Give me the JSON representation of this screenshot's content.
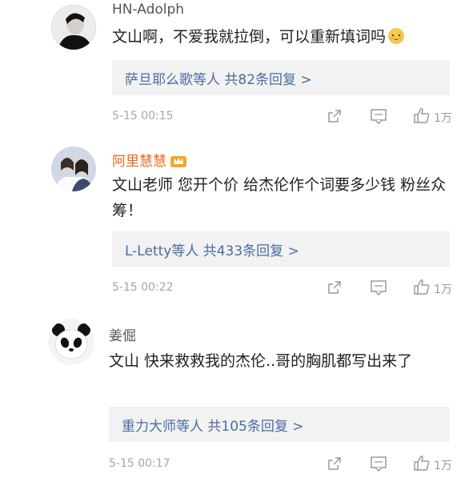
{
  "comments": [
    {
      "username": "HN-Adolph",
      "text": "文山啊，不爱我就拉倒，可以重新填词吗",
      "emoji_icon": "blush-face-emoji",
      "reply_summary": "萨旦耶么歌等人 共82条回复 >",
      "time": "5-15 00:15",
      "likes": "1万"
    },
    {
      "username": "阿里慧慧",
      "badge_icon": "vip-crown-icon",
      "text": "文山老师 您开个价 给杰伦作个词要多少钱 粉丝众筹！",
      "reply_summary": "L-Letty等人 共433条回复 >",
      "time": "5-15 00:22",
      "likes": "1万"
    },
    {
      "username": "姜倔",
      "text": "文山  快来救救我的杰伦..哥的胸肌都写出来了",
      "reply_summary": "重力大师等人 共105条回复 >",
      "time": "5-15 00:17",
      "likes": "1万"
    }
  ],
  "colors": {
    "link": "#4a6da3",
    "vip_name": "#e2691f",
    "meta": "#a6a6a6",
    "reply_bg": "#f2f2f2"
  }
}
